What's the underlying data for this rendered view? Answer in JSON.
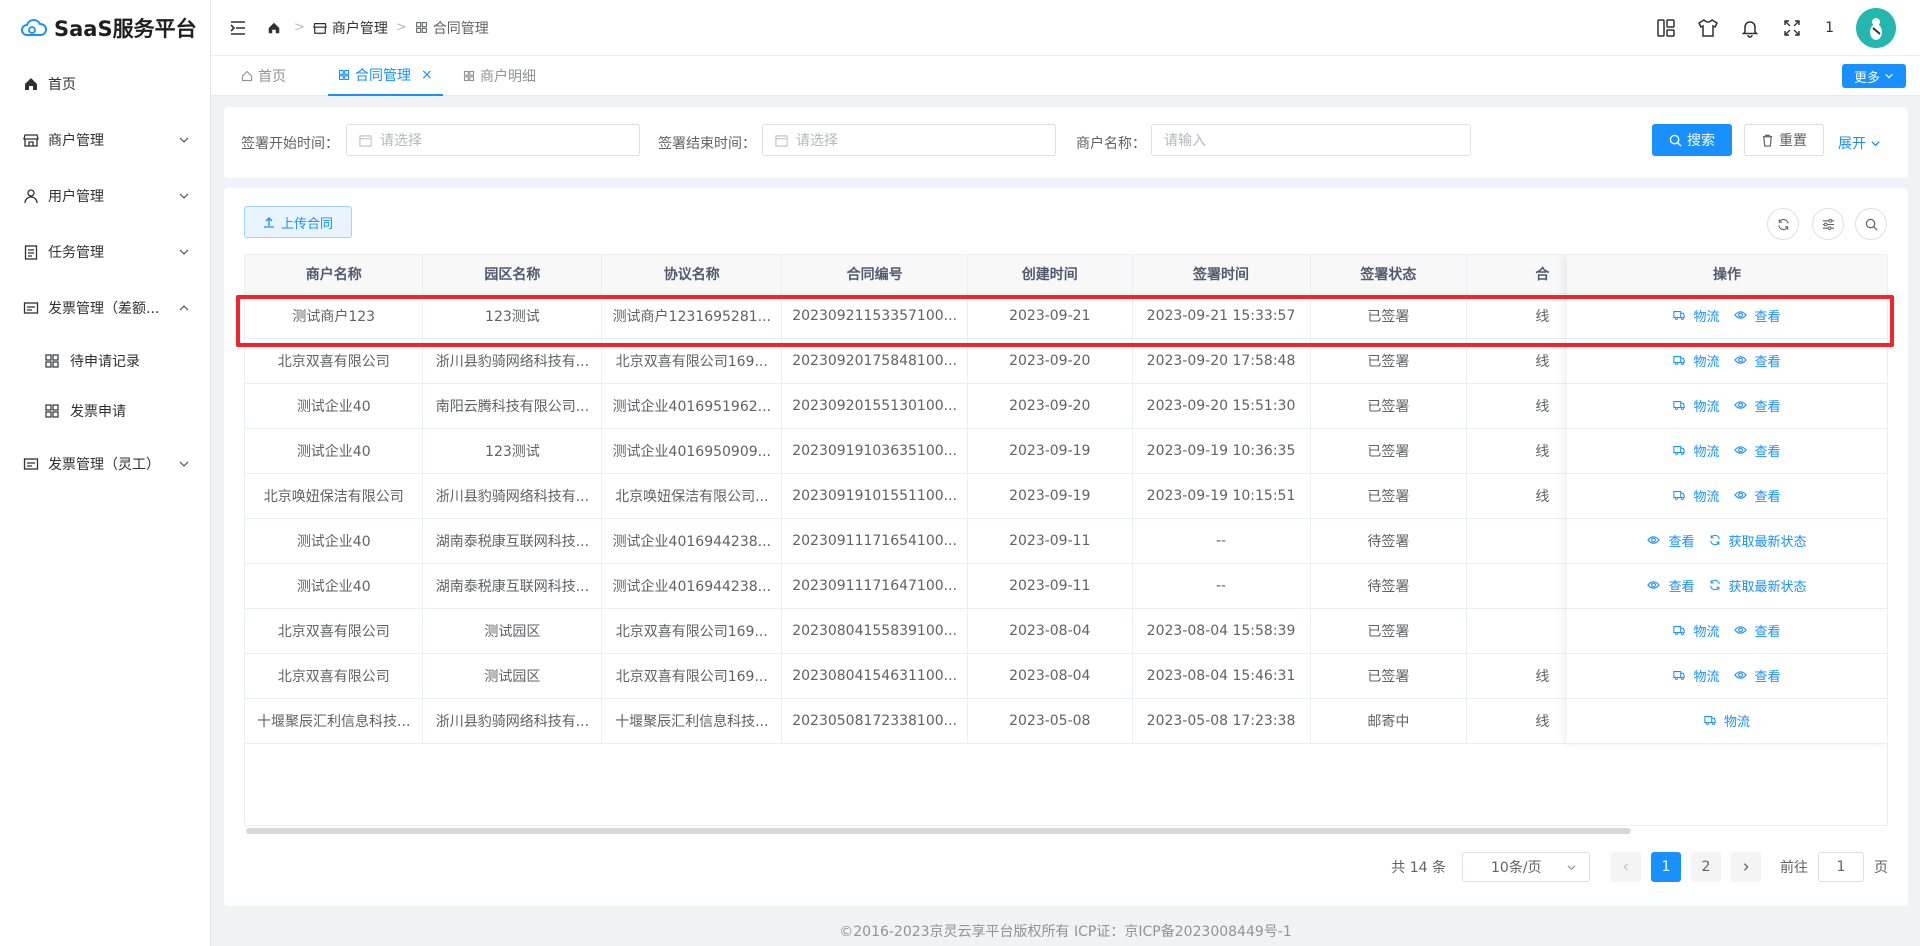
{
  "app": {
    "title": "SaaS服务平台"
  },
  "sidebar": {
    "items": [
      {
        "label": "首页",
        "icon": "home-icon"
      },
      {
        "label": "商户管理",
        "icon": "shop-icon"
      },
      {
        "label": "用户管理",
        "icon": "user-icon"
      },
      {
        "label": "任务管理",
        "icon": "task-icon"
      },
      {
        "label": "发票管理（差额...",
        "icon": "invoice-icon"
      },
      {
        "label": "发票管理（灵工）",
        "icon": "invoice-icon"
      }
    ],
    "sub_items": [
      {
        "label": "待申请记录"
      },
      {
        "label": "发票申请"
      }
    ]
  },
  "breadcrumb": {
    "level1": "商户管理",
    "level2": "合同管理"
  },
  "header": {
    "notification_count": "1"
  },
  "tabs": [
    {
      "label": "首页"
    },
    {
      "label": "合同管理"
    },
    {
      "label": "商户明细"
    }
  ],
  "more_label": "更多",
  "search": {
    "sign_start_label": "签署开始时间：",
    "sign_start_placeholder": "请选择",
    "sign_end_label": "签署结束时间：",
    "sign_end_placeholder": "请选择",
    "merchant_label": "商户名称：",
    "merchant_placeholder": "请输入",
    "search_btn": "搜索",
    "reset_btn": "重置",
    "expand_link": "展开"
  },
  "toolbar": {
    "upload_label": "上传合同"
  },
  "table": {
    "columns": [
      "商户名称",
      "园区名称",
      "协议名称",
      "合同编号",
      "创建时间",
      "签署时间",
      "签署状态",
      "合",
      "操作"
    ],
    "rows": [
      {
        "merchant": "测试商户123",
        "park": "123测试",
        "agreement": "测试商户1231695281...",
        "contract_no": "20230921153357100...",
        "created": "2023-09-21",
        "signed": "2023-09-21 15:33:57",
        "status": "已签署",
        "type": "线",
        "ops": [
          "物流",
          "查看"
        ]
      },
      {
        "merchant": "北京双喜有限公司",
        "park": "浙川县豹骑网络科技有...",
        "agreement": "北京双喜有限公司169...",
        "contract_no": "20230920175848100...",
        "created": "2023-09-20",
        "signed": "2023-09-20 17:58:48",
        "status": "已签署",
        "type": "线",
        "ops": [
          "物流",
          "查看"
        ]
      },
      {
        "merchant": "测试企业40",
        "park": "南阳云腾科技有限公司...",
        "agreement": "测试企业4016951962...",
        "contract_no": "20230920155130100...",
        "created": "2023-09-20",
        "signed": "2023-09-20 15:51:30",
        "status": "已签署",
        "type": "线",
        "ops": [
          "物流",
          "查看"
        ]
      },
      {
        "merchant": "测试企业40",
        "park": "123测试",
        "agreement": "测试企业4016950909...",
        "contract_no": "20230919103635100...",
        "created": "2023-09-19",
        "signed": "2023-09-19 10:36:35",
        "status": "已签署",
        "type": "线",
        "ops": [
          "物流",
          "查看"
        ]
      },
      {
        "merchant": "北京唤妞保洁有限公司",
        "park": "浙川县豹骑网络科技有...",
        "agreement": "北京唤妞保洁有限公司...",
        "contract_no": "20230919101551100...",
        "created": "2023-09-19",
        "signed": "2023-09-19 10:15:51",
        "status": "已签署",
        "type": "线",
        "ops": [
          "物流",
          "查看"
        ]
      },
      {
        "merchant": "测试企业40",
        "park": "湖南泰税康互联网科技...",
        "agreement": "测试企业4016944238...",
        "contract_no": "20230911171654100...",
        "created": "2023-09-11",
        "signed": "--",
        "status": "待签署",
        "type": "",
        "ops": [
          "查看",
          "获取最新状态"
        ]
      },
      {
        "merchant": "测试企业40",
        "park": "湖南泰税康互联网科技...",
        "agreement": "测试企业4016944238...",
        "contract_no": "20230911171647100...",
        "created": "2023-09-11",
        "signed": "--",
        "status": "待签署",
        "type": "",
        "ops": [
          "查看",
          "获取最新状态"
        ]
      },
      {
        "merchant": "北京双喜有限公司",
        "park": "测试园区",
        "agreement": "北京双喜有限公司169...",
        "contract_no": "20230804155839100...",
        "created": "2023-08-04",
        "signed": "2023-08-04 15:58:39",
        "status": "已签署",
        "type": "",
        "ops": [
          "物流",
          "查看"
        ]
      },
      {
        "merchant": "北京双喜有限公司",
        "park": "测试园区",
        "agreement": "北京双喜有限公司169...",
        "contract_no": "20230804154631100...",
        "created": "2023-08-04",
        "signed": "2023-08-04 15:46:31",
        "status": "已签署",
        "type": "线",
        "ops": [
          "物流",
          "查看"
        ]
      },
      {
        "merchant": "十堰聚辰汇利信息科技...",
        "park": "浙川县豹骑网络科技有...",
        "agreement": "十堰聚辰汇利信息科技...",
        "contract_no": "20230508172338100...",
        "created": "2023-05-08",
        "signed": "2023-05-08 17:23:38",
        "status": "邮寄中",
        "type": "线",
        "ops": [
          "物流"
        ]
      }
    ]
  },
  "pagination": {
    "total": "共 14 条",
    "page_size": "10条/页",
    "pages": [
      "1",
      "2"
    ],
    "current": "1",
    "goto_label": "前往",
    "goto_value": "1",
    "page_suffix": "页"
  },
  "footer": {
    "text": "©2016-2023京灵云享平台版权所有 ICP证：京ICP备2023008449号-1"
  },
  "colors": {
    "primary": "#1890ff",
    "highlight": "#f5222d"
  }
}
